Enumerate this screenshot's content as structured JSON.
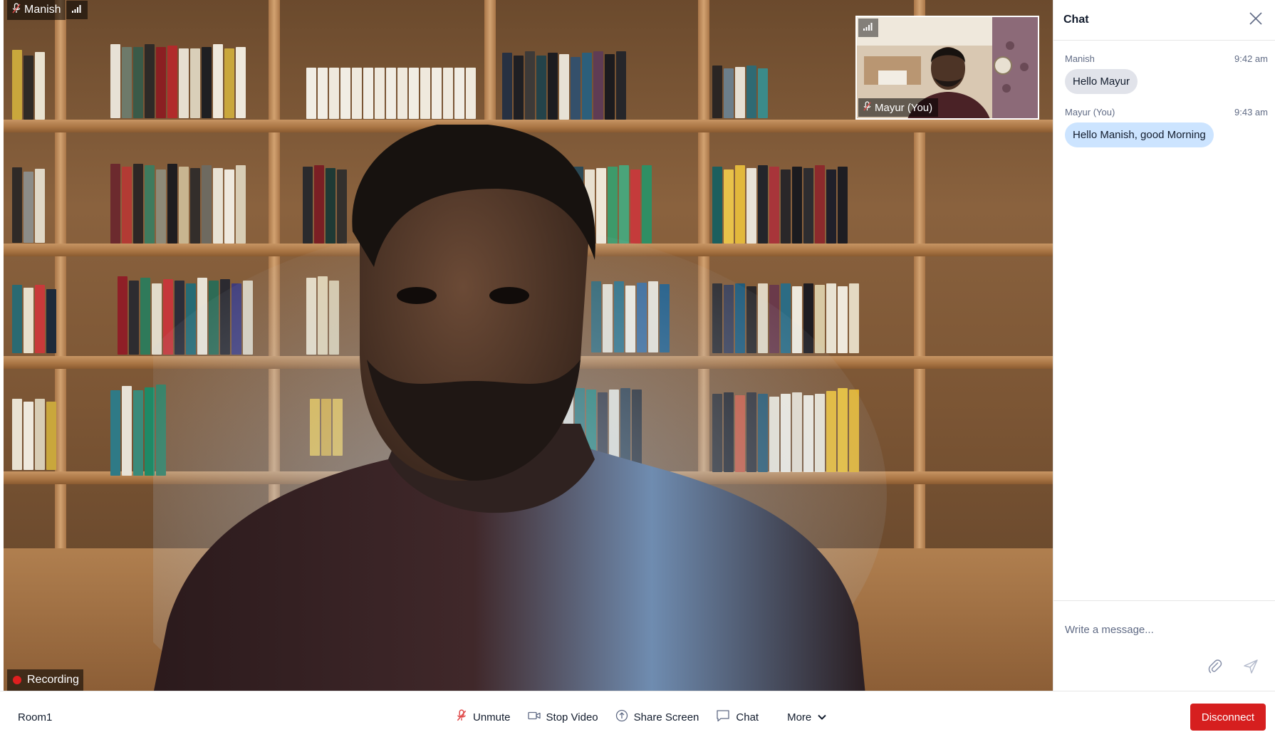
{
  "main_video": {
    "participant_name": "Manish",
    "recording_label": "Recording"
  },
  "pip_video": {
    "participant_name": "Mayur (You)"
  },
  "chat": {
    "title": "Chat",
    "messages": [
      {
        "author": "Manish",
        "time": "9:42 am",
        "text": "Hello Mayur",
        "from_self": false
      },
      {
        "author": "Mayur (You)",
        "time": "9:43 am",
        "text": "Hello Manish, good Morning",
        "from_self": true
      }
    ],
    "composer": {
      "placeholder": "Write a message..."
    }
  },
  "toolbar": {
    "room_name": "Room1",
    "unmute_label": "Unmute",
    "stop_video_label": "Stop Video",
    "share_screen_label": "Share Screen",
    "chat_label": "Chat",
    "more_label": "More",
    "disconnect_label": "Disconnect"
  },
  "colors": {
    "disconnect_red": "#d61f1f",
    "recording_red": "#e01f1f",
    "self_bubble": "#cce4ff",
    "other_bubble": "#e1e3ea"
  },
  "icons": [
    "mic-off-icon",
    "signal-icon",
    "close-icon",
    "attach-icon",
    "send-icon",
    "video-icon",
    "share-screen-icon",
    "chat-icon",
    "chevron-down-icon"
  ]
}
